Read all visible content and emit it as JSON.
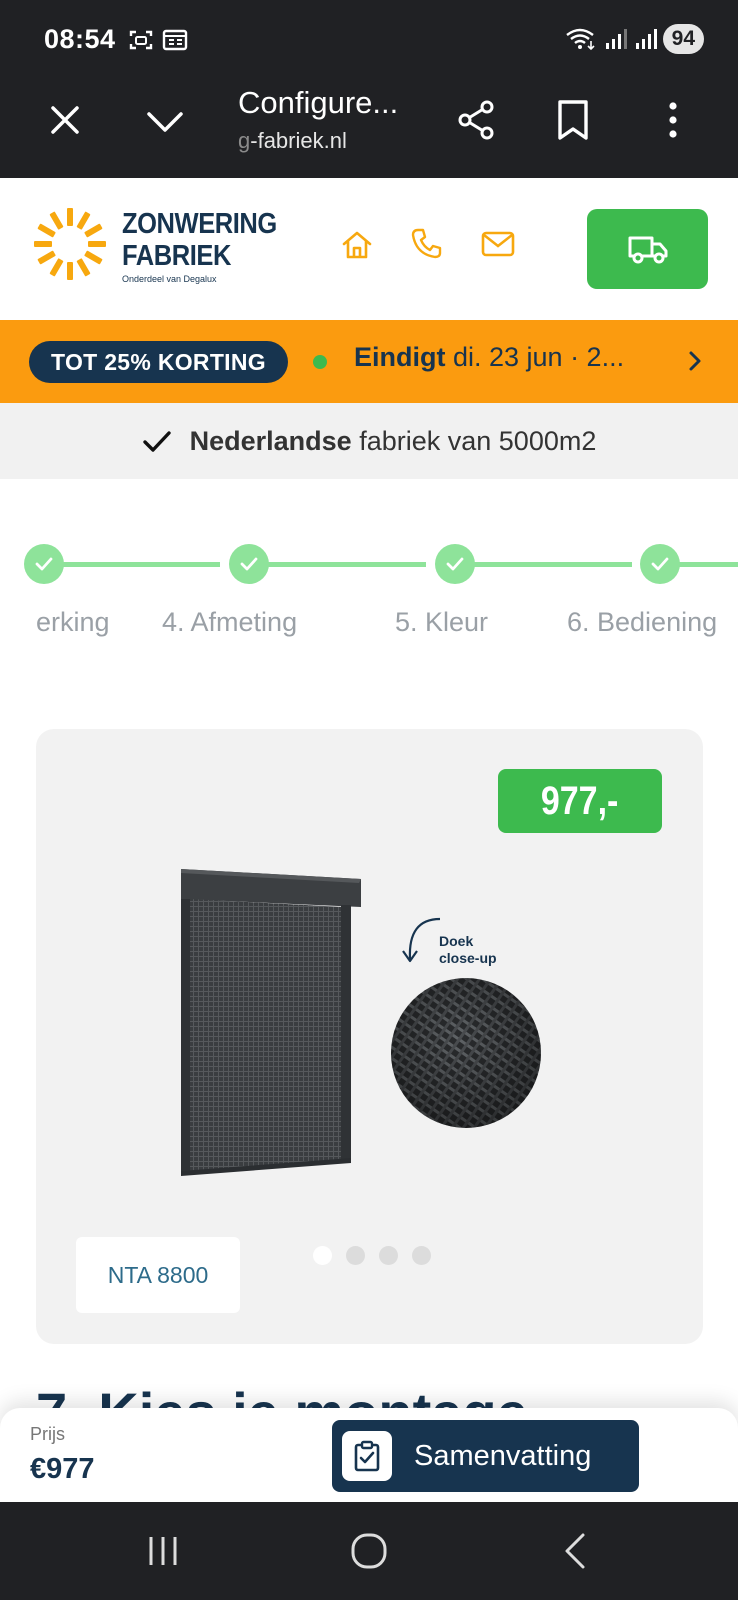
{
  "status_bar": {
    "time": "08:54",
    "battery": "94"
  },
  "browser": {
    "title": "Configure...",
    "url_dim": "g",
    "url_rest": "-fabriek.nl"
  },
  "header": {
    "logo_line1": "ZONWERING",
    "logo_line2": "FABRIEK",
    "logo_sub": "Onderdeel van Degalux",
    "accent_color": "#f7a80f",
    "cta_color": "#3dba4e"
  },
  "promo": {
    "badge": "TOT 25% KORTING",
    "ends_bold": "Eindigt",
    "ends_date": " di. 23 jun · 2..."
  },
  "usp": {
    "bold": "Nederlandse",
    "rest": "fabriek van 5000m2"
  },
  "steps": [
    {
      "label": "erking"
    },
    {
      "label": "4. Afmeting"
    },
    {
      "label": "5. Kleur"
    },
    {
      "label": "6. Bediening"
    }
  ],
  "product": {
    "price_badge": "977,-",
    "closeup_line1": "Doek",
    "closeup_line2": "close-up",
    "tag": "NTA 8800",
    "carousel_count": 4,
    "carousel_active": 0
  },
  "next_heading": "7. Kies je montage",
  "bottom_bar": {
    "price_label": "Prijs",
    "price_value": "€977",
    "summary_button": "Samenvatting"
  }
}
